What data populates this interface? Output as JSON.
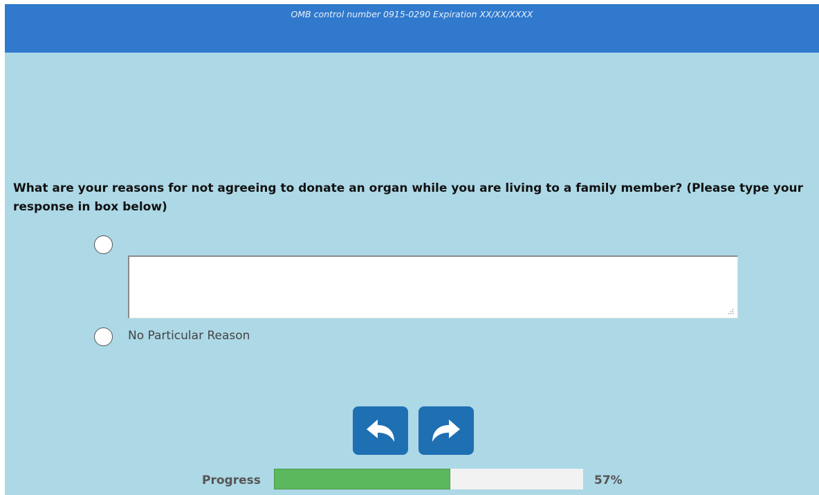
{
  "header": {
    "omb_text": "OMB control number 0915-0290 Expiration XX/XX/XXXX",
    "color": "#3079cc"
  },
  "page": {
    "background": "#add8e6"
  },
  "question": {
    "text": "What are your reasons for not agreeing to donate an organ while you are living to a family member? (Please type your response in box below)"
  },
  "options": [
    {
      "type": "text-entry",
      "value": "",
      "selected": false
    },
    {
      "label": "No Particular Reason",
      "selected": false
    }
  ],
  "navigation": {
    "back_icon": "back-arrow-icon",
    "next_icon": "forward-arrow-icon",
    "button_color": "#1f6fb3"
  },
  "progress": {
    "label": "Progress",
    "percent": 57,
    "percent_text": "57%",
    "fill_color": "#5cb85c"
  }
}
